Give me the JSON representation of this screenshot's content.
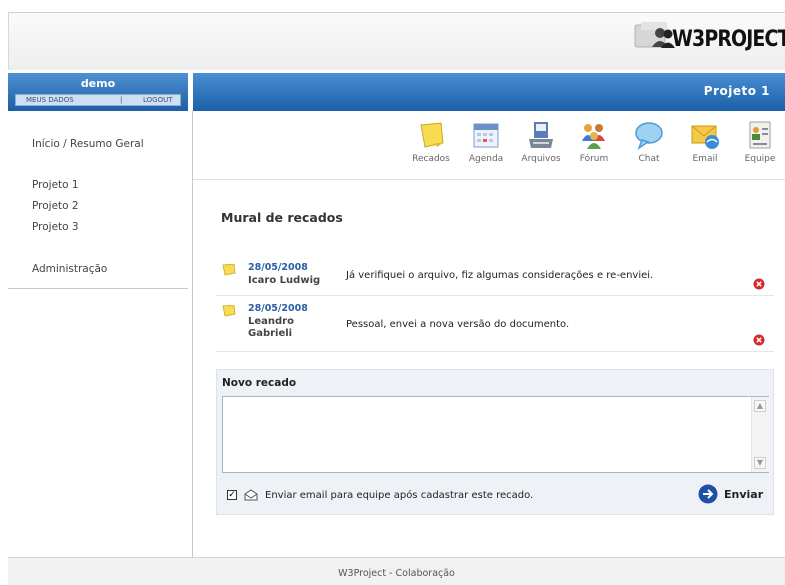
{
  "brand": {
    "name": "W3PROJECT"
  },
  "user": {
    "name": "demo",
    "links": [
      "MEUS DADOS",
      "|",
      "LOGOUT"
    ]
  },
  "project": {
    "title": "Projeto 1"
  },
  "sidebar": {
    "home": "Início / Resumo Geral",
    "projects": [
      "Projeto 1",
      "Projeto 2",
      "Projeto 3"
    ],
    "admin": "Administração"
  },
  "toolbar": [
    {
      "label": "Recados",
      "icon": "note-icon"
    },
    {
      "label": "Agenda",
      "icon": "calendar-icon"
    },
    {
      "label": "Arquivos",
      "icon": "files-icon"
    },
    {
      "label": "Fórum",
      "icon": "forum-icon"
    },
    {
      "label": "Chat",
      "icon": "chat-icon"
    },
    {
      "label": "Email",
      "icon": "email-icon"
    },
    {
      "label": "Equipe",
      "icon": "team-icon"
    }
  ],
  "mural": {
    "title": "Mural de recados",
    "messages": [
      {
        "date": "28/05/2008",
        "author": "Icaro Ludwig",
        "text": "Já verifiquei o arquivo, fiz algumas considerações e re-enviei."
      },
      {
        "date": "28/05/2008",
        "author": "Leandro Gabrieli",
        "text": "Pessoal, envei a nova versão do documento."
      }
    ]
  },
  "new_message": {
    "title": "Novo recado",
    "textarea_value": "",
    "checkbox_checked": true,
    "checkbox_label": "Enviar email para equipe após cadastrar este recado.",
    "send_label": "Enviar"
  },
  "footer": {
    "text": "W3Project - Colaboração"
  },
  "colors": {
    "accent": "#1d5ea6",
    "date": "#2a5fa5",
    "delete": "#d42a2a"
  }
}
